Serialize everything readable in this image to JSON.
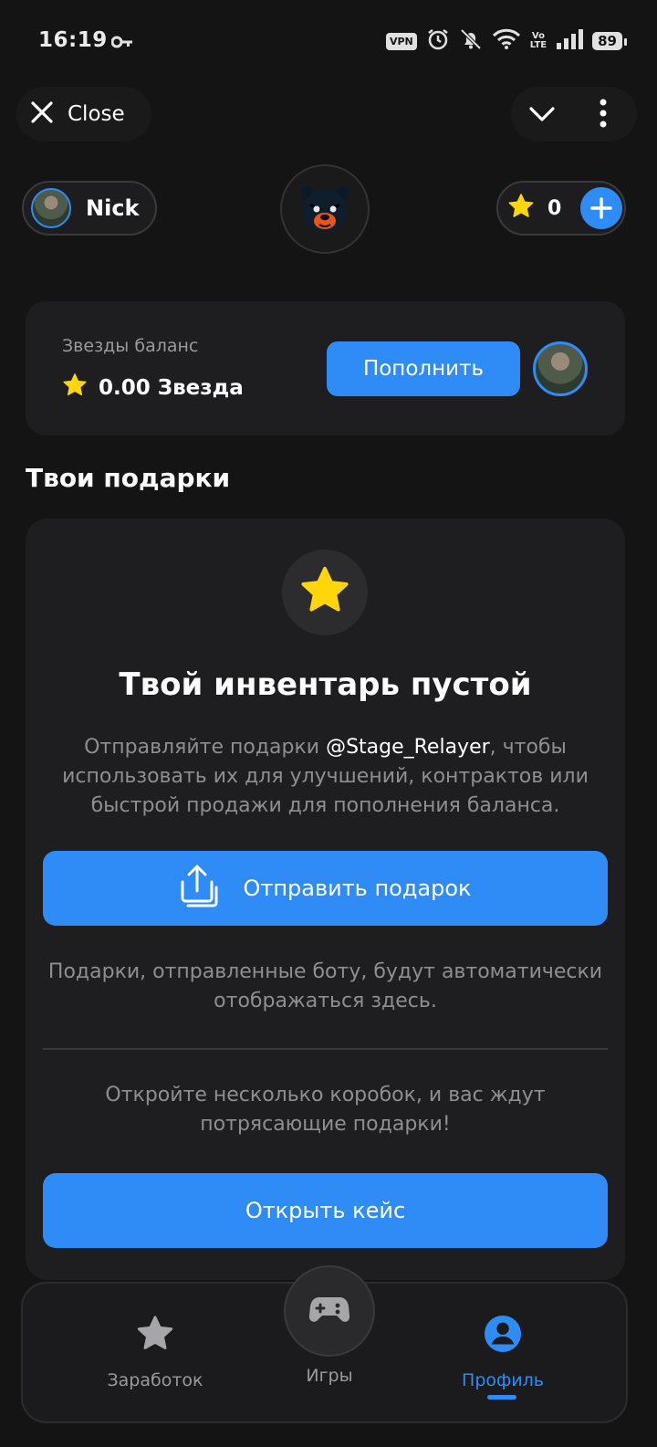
{
  "status_bar": {
    "time": "16:19",
    "vpn": "VPN",
    "volte_top": "Vo",
    "volte_bottom": "LTE",
    "battery": "89",
    "icons": [
      "key-icon",
      "vpn-icon",
      "alarm-icon",
      "bell-off-icon",
      "wifi-icon",
      "volte-icon",
      "signal-icon",
      "battery-icon"
    ]
  },
  "top_nav": {
    "close_label": "Close",
    "icons": [
      "close-icon",
      "chevron-down-icon",
      "more-vertical-icon"
    ]
  },
  "header": {
    "user_name": "Nick",
    "stars_count": "0",
    "icons": [
      "avatar",
      "bear-logo",
      "star-icon",
      "plus-icon"
    ]
  },
  "balance": {
    "label": "Звезды баланс",
    "value": "0.00 Звезда",
    "topup_label": "Пополнить"
  },
  "gifts": {
    "section_title": "Твои подарки",
    "empty_title": "Твой инвентарь пустой",
    "desc_before": "Отправляйте подарки ",
    "desc_mention": "@Stage_Relayer",
    "desc_after": ", чтобы использовать их для улучшений, контрактов или быстрой продажи для пополнения баланса.",
    "send_label": "Отправить подарок",
    "auto_note": "Подарки, отправленные боту, будут автоматически отображаться здесь.",
    "boxes_note": "Откройте несколько коробок, и вас ждут потрясающие подарки!",
    "case_label": "Открыть кейс"
  },
  "bottom_nav": {
    "items": [
      {
        "label": "Заработок",
        "icon": "star-icon",
        "active": false
      },
      {
        "label": "Игры",
        "icon": "gamepad-icon",
        "active": false
      },
      {
        "label": "Профиль",
        "icon": "profile-icon",
        "active": true
      }
    ]
  },
  "colors": {
    "background": "#141414",
    "card": "#1e1e20",
    "accent": "#2f8cf7",
    "star": "#ffd60a",
    "muted_text": "#8e8e93"
  }
}
